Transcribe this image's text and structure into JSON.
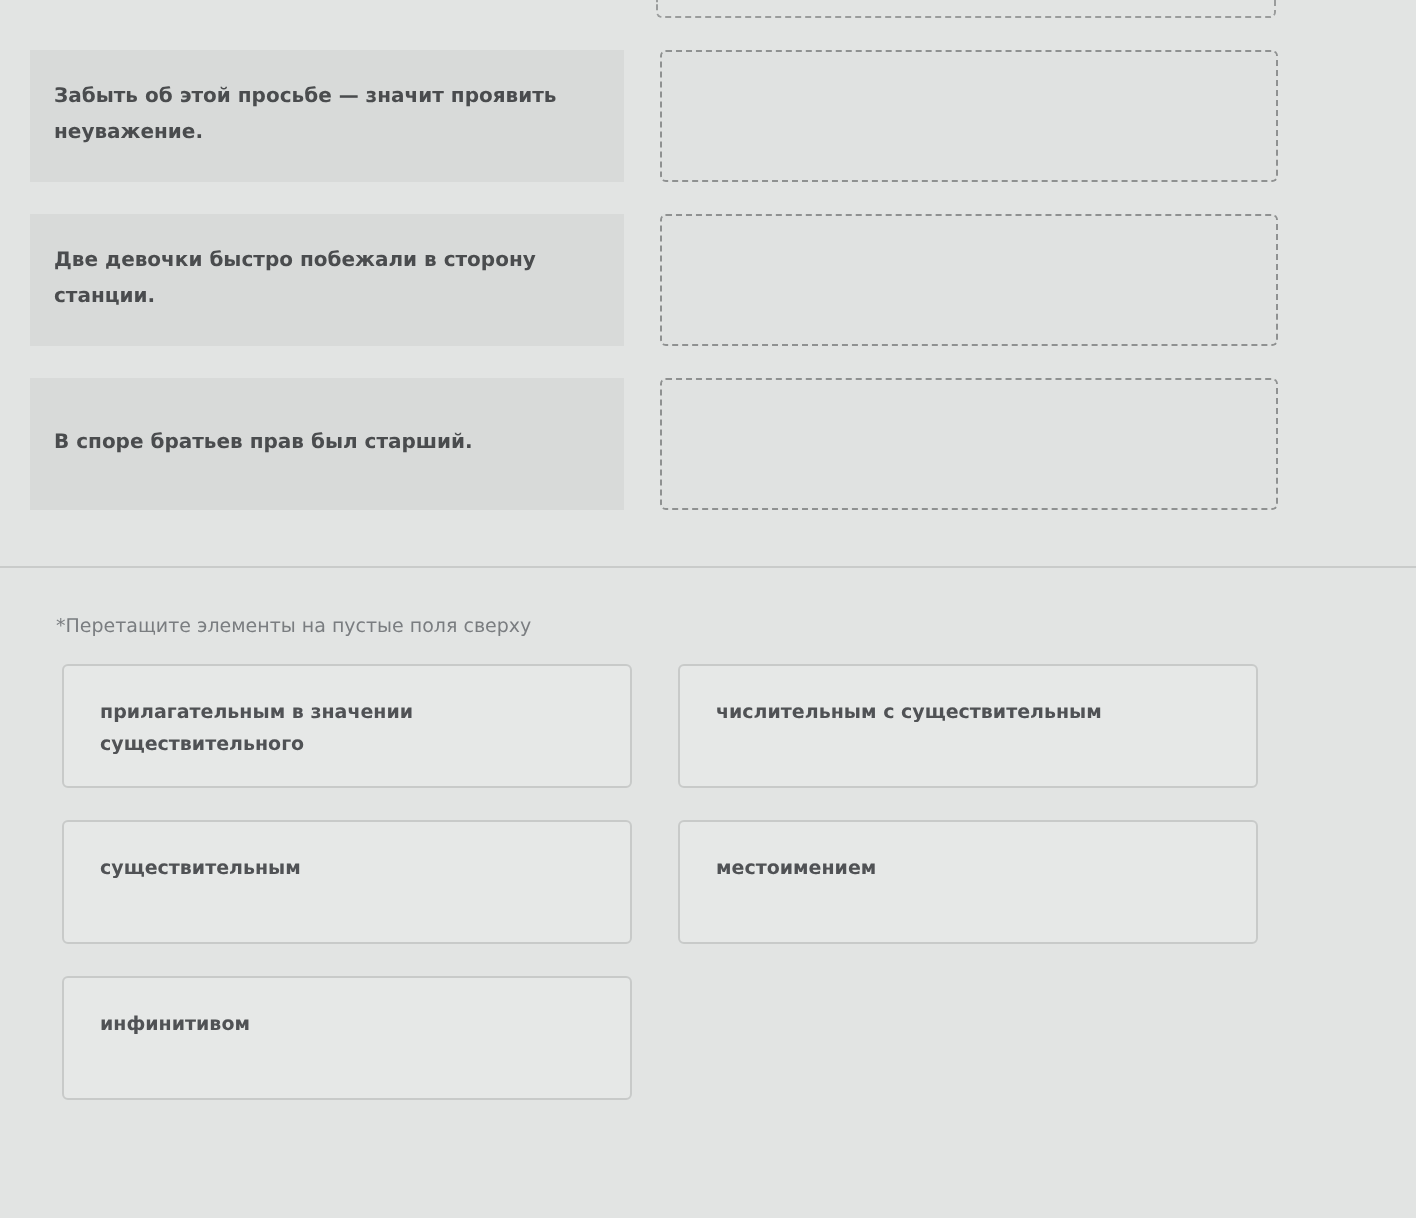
{
  "pairs": [
    {
      "sentence": "Забыть об этой просьбе — значит проявить неуважение."
    },
    {
      "sentence": "Две девочки быстро побежали в сторону станции."
    },
    {
      "sentence": "В споре братьев прав был старший."
    }
  ],
  "hint": "*Перетащите элементы на пустые поля сверху",
  "options": [
    {
      "label": "прилагательным в значении существительного"
    },
    {
      "label": "числительным с существительным"
    },
    {
      "label": "существительным"
    },
    {
      "label": "местоимением"
    },
    {
      "label": "инфинитивом"
    }
  ]
}
